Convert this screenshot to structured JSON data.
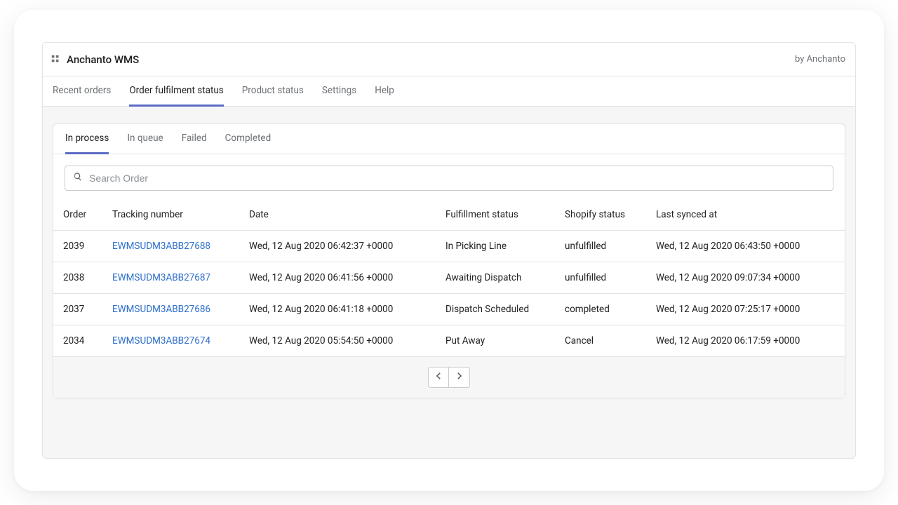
{
  "header": {
    "title": "Anchanto WMS",
    "byline": "by Anchanto"
  },
  "topTabs": [
    {
      "label": "Recent orders"
    },
    {
      "label": "Order fulfilment status"
    },
    {
      "label": "Product status"
    },
    {
      "label": "Settings"
    },
    {
      "label": "Help"
    }
  ],
  "subTabs": [
    {
      "label": "In process"
    },
    {
      "label": "In queue"
    },
    {
      "label": "Failed"
    },
    {
      "label": "Completed"
    }
  ],
  "search": {
    "placeholder": "Search Order"
  },
  "columns": {
    "order": "Order",
    "tracking": "Tracking number",
    "date": "Date",
    "fulfillment": "Fulfillment status",
    "shopify": "Shopify status",
    "synced": "Last synced at"
  },
  "rows": [
    {
      "order": "2039",
      "tracking": "EWMSUDM3ABB27688",
      "date": "Wed, 12 Aug 2020 06:42:37 +0000",
      "fulfillment": "In Picking Line",
      "shopify": "unfulfilled",
      "synced": "Wed, 12 Aug 2020 06:43:50 +0000"
    },
    {
      "order": "2038",
      "tracking": "EWMSUDM3ABB27687",
      "date": "Wed, 12 Aug 2020 06:41:56 +0000",
      "fulfillment": "Awaiting Dispatch",
      "shopify": "unfulfilled",
      "synced": "Wed, 12 Aug 2020 09:07:34 +0000"
    },
    {
      "order": "2037",
      "tracking": "EWMSUDM3ABB27686",
      "date": "Wed, 12 Aug 2020 06:41:18 +0000",
      "fulfillment": "Dispatch Scheduled",
      "shopify": "completed",
      "synced": "Wed, 12 Aug 2020 07:25:17 +0000"
    },
    {
      "order": "2034",
      "tracking": "EWMSUDM3ABB27674",
      "date": "Wed, 12 Aug 2020 05:54:50 +0000",
      "fulfillment": "Put Away",
      "shopify": "Cancel",
      "synced": "Wed, 12 Aug 2020 06:17:59 +0000"
    }
  ]
}
